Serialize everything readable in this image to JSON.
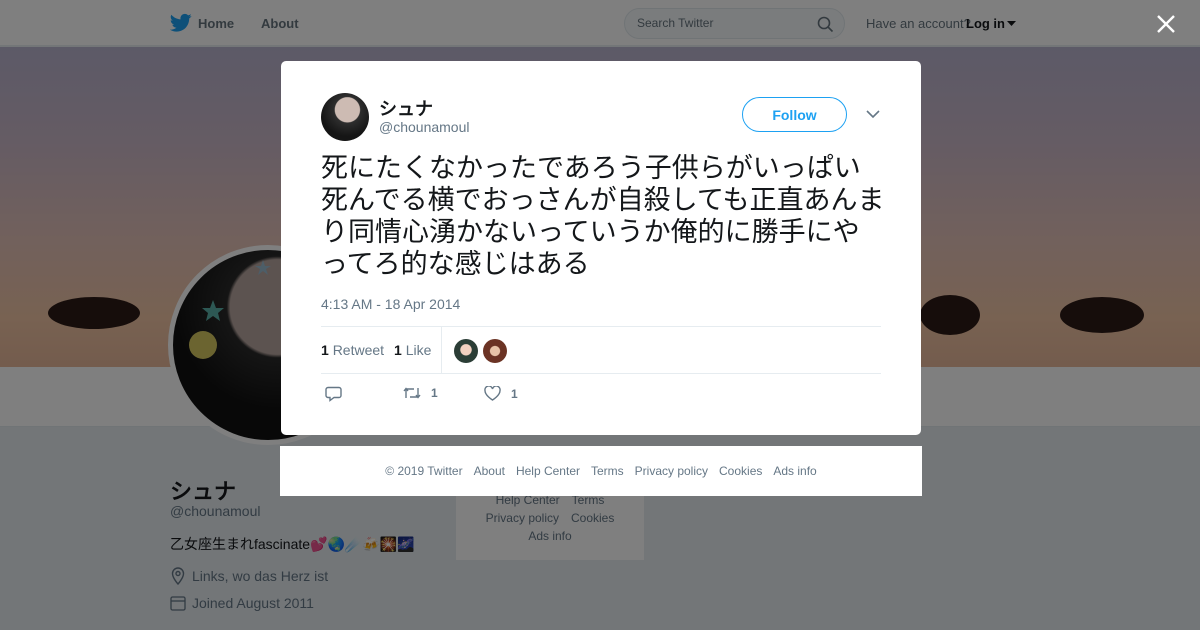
{
  "topbar": {
    "home_label": "Home",
    "about_label": "About",
    "search_placeholder": "Search Twitter",
    "account_prompt": "Have an account?",
    "login_label": "Log in"
  },
  "profile": {
    "name": "シュナ",
    "handle": "@chounamoul",
    "bio": "乙女座生まれfascinate💕🌏☄️🍻🎇🌌",
    "location": "Links, wo das Herz ist",
    "joined": "Joined August 2011",
    "side_links": {
      "help_center": "Help Center",
      "terms": "Terms",
      "privacy": "Privacy policy",
      "cookies": "Cookies",
      "ads_info": "Ads info"
    }
  },
  "tweet": {
    "author_name": "シュナ",
    "author_handle": "@chounamoul",
    "follow_label": "Follow",
    "text": "死にたくなかったであろう子供らがいっぱい死んでる横でおっさんが自殺しても正直あんまり同情心湧かないっていうか俺的に勝手にやってろ的な感じはある",
    "timestamp": "4:13 AM - 18 Apr 2014",
    "retweet_count": "1",
    "retweet_label": "Retweet",
    "like_count": "1",
    "like_label": "Like",
    "action_retweet_count": "1",
    "action_like_count": "1"
  },
  "footer": {
    "copyright": "© 2019 Twitter",
    "about": "About",
    "help_center": "Help Center",
    "terms": "Terms",
    "privacy": "Privacy policy",
    "cookies": "Cookies",
    "ads_info": "Ads info"
  },
  "colors": {
    "twitter_blue": "#1da1f2",
    "text_primary": "#14171a",
    "text_secondary": "#657786"
  }
}
